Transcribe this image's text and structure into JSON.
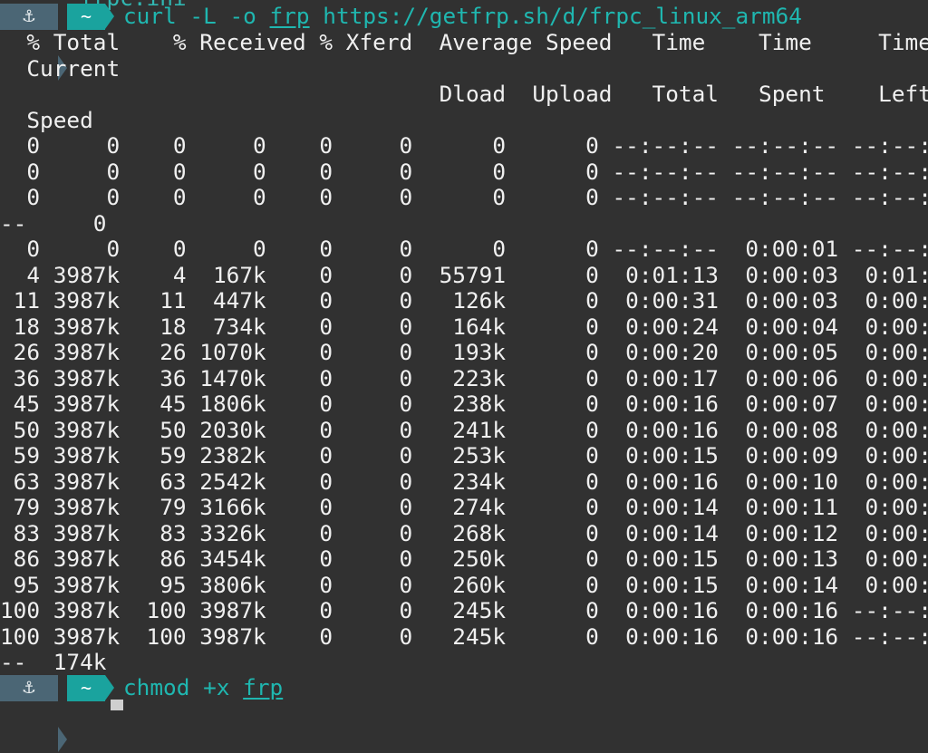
{
  "window": {
    "partial_top_line": "~  ~  frpc.ini"
  },
  "prompt": {
    "anchor_icon": "anchor-icon",
    "dir": "~",
    "accent": "#1aa39e",
    "anchor_bg": "#4b6675"
  },
  "commands": [
    {
      "text": "curl -L -o ",
      "arg": "frp",
      "rest": " https://getfrp.sh/d/frpc_linux_arm64"
    },
    {
      "text": "chmod +x ",
      "arg": "frp",
      "rest": ""
    }
  ],
  "output": {
    "lines": [
      "  % Total    % Received % Xferd  Average Speed   Time    Time     Time",
      "  Current",
      "                                 Dload  Upload   Total   Spent    Left",
      "  Speed",
      "  0     0    0     0    0     0      0      0 --:--:-- --:--:-- --:--:",
      "  0     0    0     0    0     0      0      0 --:--:-- --:--:-- --:--:",
      "  0     0    0     0    0     0      0      0 --:--:-- --:--:-- --:--:",
      "--     0",
      "  0     0    0     0    0     0      0      0 --:--:--  0:00:01 --:--:",
      "  4 3987k    4  167k    0     0  55791      0  0:01:13  0:00:03  0:01:",
      " 11 3987k   11  447k    0     0   126k      0  0:00:31  0:00:03  0:00:",
      " 18 3987k   18  734k    0     0   164k      0  0:00:24  0:00:04  0:00:",
      " 26 3987k   26 1070k    0     0   193k      0  0:00:20  0:00:05  0:00:",
      " 36 3987k   36 1470k    0     0   223k      0  0:00:17  0:00:06  0:00:",
      " 45 3987k   45 1806k    0     0   238k      0  0:00:16  0:00:07  0:00:",
      " 50 3987k   50 2030k    0     0   241k      0  0:00:16  0:00:08  0:00:",
      " 59 3987k   59 2382k    0     0   253k      0  0:00:15  0:00:09  0:00:",
      " 63 3987k   63 2542k    0     0   234k      0  0:00:16  0:00:10  0:00:",
      " 79 3987k   79 3166k    0     0   274k      0  0:00:14  0:00:11  0:00:",
      " 83 3987k   83 3326k    0     0   268k      0  0:00:14  0:00:12  0:00:",
      " 86 3987k   86 3454k    0     0   250k      0  0:00:15  0:00:13  0:00:",
      " 95 3987k   95 3806k    0     0   260k      0  0:00:15  0:00:14  0:00:",
      "100 3987k  100 3987k    0     0   245k      0  0:00:16  0:00:16 --:--:",
      "100 3987k  100 3987k    0     0   245k      0  0:00:16  0:00:16 --:--:",
      "--  174k"
    ]
  }
}
